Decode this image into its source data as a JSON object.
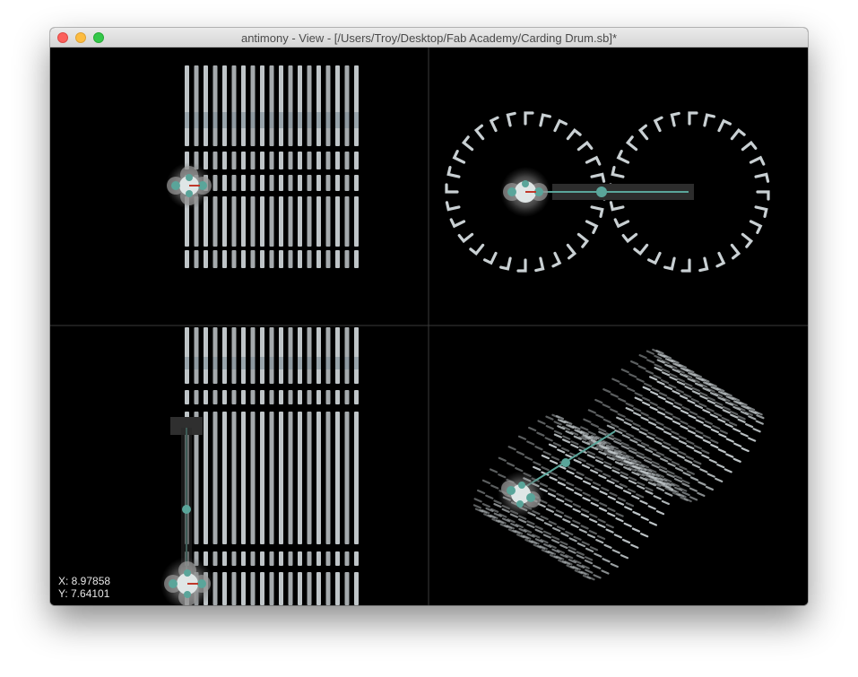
{
  "window": {
    "title": "antimony - View - [/Users/Troy/Desktop/Fab Academy/Carding Drum.sb]*"
  },
  "colors": {
    "divider": "#3a3a3a",
    "teeth": "#c9d0d3",
    "node": "#5aa59a",
    "node_glow": "#8a8a8a",
    "accent_red": "#c0392b"
  },
  "status": {
    "x_label": "X: 8.97858",
    "y_label": "Y: 7.64101"
  },
  "viewports": [
    {
      "name": "top-view"
    },
    {
      "name": "front-view"
    },
    {
      "name": "side-view"
    },
    {
      "name": "3d-view"
    }
  ]
}
